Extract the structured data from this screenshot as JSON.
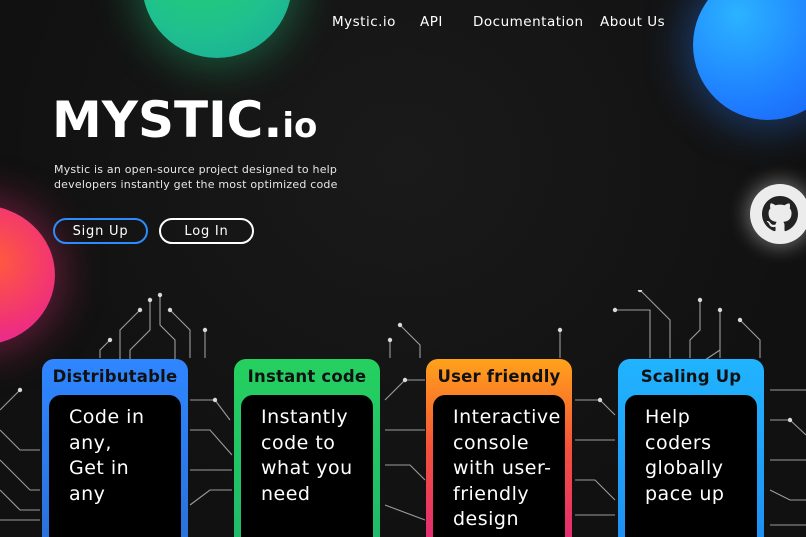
{
  "nav": {
    "items": [
      {
        "label": "Mystic.io"
      },
      {
        "label": "API"
      },
      {
        "label": "Documentation"
      },
      {
        "label": "About Us"
      }
    ]
  },
  "hero": {
    "logo_main": "MYSTIC.",
    "logo_suffix": "io",
    "tagline_line1": "Mystic is an open-source project designed to help",
    "tagline_line2": "developers instantly get the most optimized code",
    "signup_label": "Sign Up",
    "login_label": "Log In"
  },
  "github": {
    "icon": "github-icon"
  },
  "colors": {
    "signup_border": "#2c8cff",
    "card_blue": "#2f86ff",
    "card_green": "#25d060",
    "card_orange": "#ffa21a",
    "card_cyan": "#21b4ff"
  },
  "cards": [
    {
      "title": "Distributable",
      "lines": [
        "Code in",
        "any,",
        "Get in",
        "any"
      ]
    },
    {
      "title": "Instant code",
      "lines": [
        "Instantly",
        "code to",
        "what you",
        "need"
      ]
    },
    {
      "title": "User friendly",
      "lines": [
        "Interactive",
        "console",
        "with user-",
        "friendly",
        "design"
      ]
    },
    {
      "title": "Scaling Up",
      "lines": [
        "Help",
        "coders",
        "globally",
        "pace up"
      ]
    }
  ]
}
